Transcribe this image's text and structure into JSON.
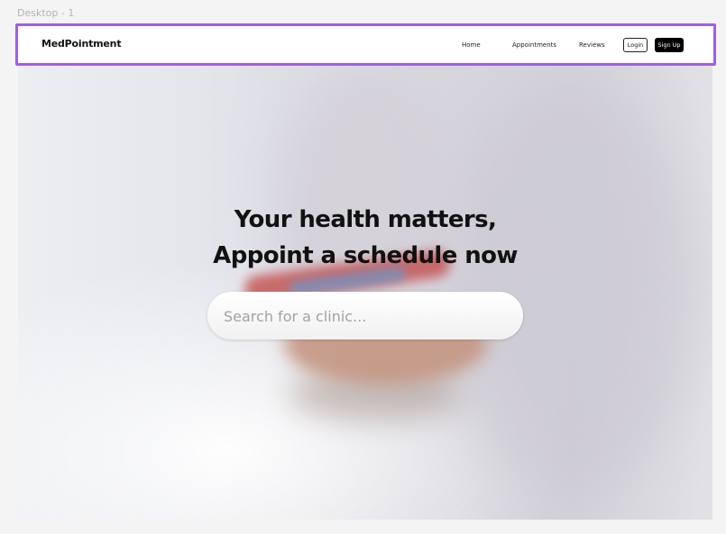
{
  "canvas": {
    "frame_label": "Desktop - 1"
  },
  "navbar": {
    "brand": "MedPointment",
    "links": [
      "Home",
      "Appointments",
      "Reviews"
    ],
    "login_label": "Login",
    "signup_label": "Sign Up",
    "selection_color": "#9e5fe6"
  },
  "hero": {
    "headline_line1": "Your health matters,",
    "headline_line2": "Appoint a schedule now",
    "search_placeholder": "Search for a clinic..."
  }
}
